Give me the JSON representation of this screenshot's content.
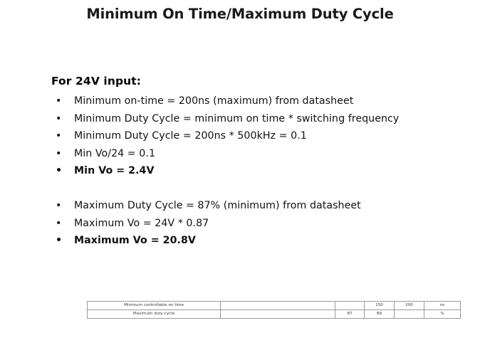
{
  "slide": {
    "title": "Minimum On Time/Maximum Duty Cycle",
    "lead_in": "For 24V input:",
    "bullet_mark": "•",
    "bullets_group_one": [
      {
        "text": "Minimum on-time = 200ns (maximum) from datasheet",
        "bold": false
      },
      {
        "text": "Minimum Duty Cycle = minimum on time * switching frequency",
        "bold": false
      },
      {
        "text": "Minimum Duty Cycle = 200ns * 500kHz = 0.1",
        "bold": false
      },
      {
        "text": "Min Vo/24 = 0.1",
        "bold": false
      },
      {
        "text": "Min Vo = 2.4V",
        "bold": true
      }
    ],
    "bullets_group_two": [
      {
        "text": "Maximum Duty Cycle = 87% (minimum) from datasheet",
        "bold": false
      },
      {
        "text": "Maximum Vo = 24V * 0.87",
        "bold": false
      },
      {
        "text": "Maximum Vo = 20.8V",
        "bold": true
      }
    ]
  },
  "datasheet_table": {
    "rows": [
      {
        "parameter": "Minimum controllable on time",
        "conditions": "",
        "min": "",
        "typ": "150",
        "max": "200",
        "unit": "ns"
      },
      {
        "parameter": "Maximum duty cycle",
        "conditions": "",
        "min": "87",
        "typ": "89",
        "max": "",
        "unit": "%"
      }
    ]
  }
}
